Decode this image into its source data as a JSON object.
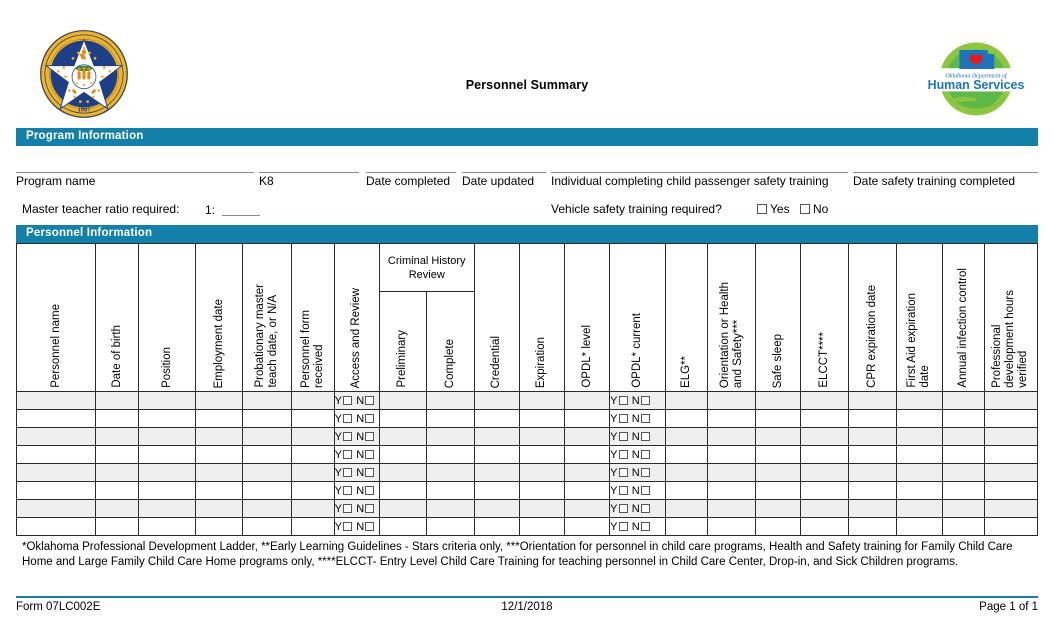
{
  "document": {
    "title": "Personnel Summary",
    "seal_label": "great-seal-of-the-state-of-oklahoma",
    "seal_text_top": "GREAT SEAL OF THE STATE OF OKLAHOMA",
    "seal_year": "1907",
    "agency_logo_line1": "Oklahoma Department of",
    "agency_logo_line2": "Human Services"
  },
  "colors": {
    "accent_blue": "#1380a9",
    "row_shade": "#efefef",
    "grid_line": "#2b2b2b"
  },
  "program_section": {
    "bar_label": "Program Information",
    "fields": [
      {
        "label": "Program name",
        "value": ""
      },
      {
        "label": "K8",
        "value": ""
      },
      {
        "label": "Date completed",
        "value": ""
      },
      {
        "label": "Date updated",
        "value": ""
      },
      {
        "label": "Individual completing child passenger safety training",
        "value": ""
      },
      {
        "label": "Date safety training completed",
        "value": ""
      }
    ],
    "master_teacher_ratio_label": "Master teacher ratio required:",
    "master_teacher_ratio_prefix": "1:",
    "master_teacher_ratio_value": "",
    "vehicle_safety_question": "Vehicle safety training required?",
    "vehicle_safety_yes": "Yes",
    "vehicle_safety_no": "No"
  },
  "personnel_section": {
    "bar_label": "Personnel Information",
    "group_header": "Criminal\nHistory\nReview",
    "columns": [
      "Personnel name",
      "Date of birth",
      "Position",
      "Employment date",
      "Probationary master\nteach date, or N/A",
      "Personnel form\nreceived",
      "Access and Review",
      "Preliminary",
      "Complete",
      "Credential",
      "Expiration",
      "OPDL* level",
      "OPDL* current",
      "ELG**",
      "Orientation or Health\nand Safety***",
      "Safe sleep",
      "ELCCT****",
      "CPR expiration date",
      "First Aid expiration\ndate",
      "Annual infection control",
      "Professional\ndevelopment hours\nverified"
    ],
    "yes_no": {
      "yes": "Y",
      "no": "N"
    },
    "yes_no_columns": [
      "Access and Review",
      "OPDL* current"
    ],
    "row_count": 8,
    "rows": [
      {
        "shaded": true,
        "cells": [
          "",
          "",
          "",
          "",
          "",
          "",
          "YN",
          "",
          "",
          "",
          "",
          "",
          "YN",
          "",
          "",
          "",
          "",
          "",
          "",
          "",
          ""
        ]
      },
      {
        "shaded": false,
        "cells": [
          "",
          "",
          "",
          "",
          "",
          "",
          "YN",
          "",
          "",
          "",
          "",
          "",
          "YN",
          "",
          "",
          "",
          "",
          "",
          "",
          "",
          ""
        ]
      },
      {
        "shaded": true,
        "cells": [
          "",
          "",
          "",
          "",
          "",
          "",
          "YN",
          "",
          "",
          "",
          "",
          "",
          "YN",
          "",
          "",
          "",
          "",
          "",
          "",
          "",
          ""
        ]
      },
      {
        "shaded": false,
        "cells": [
          "",
          "",
          "",
          "",
          "",
          "",
          "YN",
          "",
          "",
          "",
          "",
          "",
          "YN",
          "",
          "",
          "",
          "",
          "",
          "",
          "",
          ""
        ]
      },
      {
        "shaded": true,
        "cells": [
          "",
          "",
          "",
          "",
          "",
          "",
          "YN",
          "",
          "",
          "",
          "",
          "",
          "YN",
          "",
          "",
          "",
          "",
          "",
          "",
          "",
          ""
        ]
      },
      {
        "shaded": false,
        "cells": [
          "",
          "",
          "",
          "",
          "",
          "",
          "YN",
          "",
          "",
          "",
          "",
          "",
          "YN",
          "",
          "",
          "",
          "",
          "",
          "",
          "",
          ""
        ]
      },
      {
        "shaded": true,
        "cells": [
          "",
          "",
          "",
          "",
          "",
          "",
          "YN",
          "",
          "",
          "",
          "",
          "",
          "YN",
          "",
          "",
          "",
          "",
          "",
          "",
          "",
          ""
        ]
      },
      {
        "shaded": false,
        "cells": [
          "",
          "",
          "",
          "",
          "",
          "",
          "YN",
          "",
          "",
          "",
          "",
          "",
          "YN",
          "",
          "",
          "",
          "",
          "",
          "",
          "",
          ""
        ]
      }
    ]
  },
  "footnote": "*Oklahoma Professional Development Ladder, **Early Learning Guidelines - Stars criteria only, ***Orientation for personnel in child care programs, Health and Safety training for Family Child Care Home and Large Family Child Care Home programs only, ****ELCCT- Entry Level Child Care Training for teaching personnel in Child Care Center, Drop-in, and Sick Children programs.",
  "footer": {
    "form_number": "Form 07LC002E",
    "date": "12/1/2018",
    "page": "Page 1 of 1"
  }
}
